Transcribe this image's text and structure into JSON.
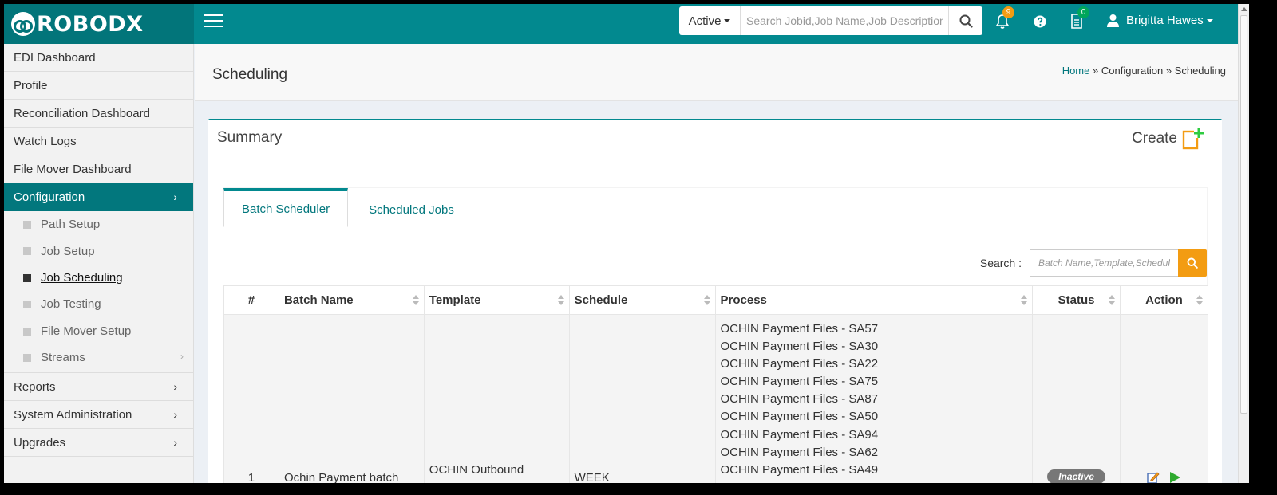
{
  "app": {
    "logo_text": "ROBODX"
  },
  "header": {
    "status_filter": "Active",
    "search_placeholder": "Search Jobid,Job Name,Job Description,Batch Name",
    "notifications_count": "9",
    "tasks_count": "0",
    "user_name": "Brigitta Hawes"
  },
  "sidebar": {
    "items": [
      {
        "label": "EDI Dashboard"
      },
      {
        "label": "Profile"
      },
      {
        "label": "Reconciliation Dashboard"
      },
      {
        "label": "Watch Logs"
      },
      {
        "label": "File Mover Dashboard"
      },
      {
        "label": "Configuration"
      },
      {
        "label": "Reports"
      },
      {
        "label": "System Administration"
      },
      {
        "label": "Upgrades"
      }
    ],
    "submenu": [
      {
        "label": "Path Setup"
      },
      {
        "label": "Job Setup"
      },
      {
        "label": "Job Scheduling"
      },
      {
        "label": "Job Testing"
      },
      {
        "label": "File Mover Setup"
      },
      {
        "label": "Streams"
      }
    ]
  },
  "page": {
    "title": "Scheduling",
    "breadcrumb": {
      "home": "Home",
      "sep": "»",
      "level1": "Configuration",
      "level2": "Scheduling"
    }
  },
  "summary": {
    "title": "Summary",
    "create_label": "Create",
    "tabs": [
      {
        "label": "Batch Scheduler"
      },
      {
        "label": "Scheduled Jobs"
      }
    ],
    "search_label": "Search :",
    "search_placeholder": "Batch Name,Template,Schedule",
    "columns": [
      "#",
      "Batch Name",
      "Template",
      "Schedule",
      "Process",
      "Status",
      "Action"
    ],
    "rows": [
      {
        "index": "1",
        "batch_name": "Ochin Payment batch",
        "template": "OCHIN Outbound",
        "schedule": "WEEK",
        "processes": [
          "OCHIN Payment Files - SA57",
          "OCHIN Payment Files - SA30",
          "OCHIN Payment Files - SA22",
          "OCHIN Payment Files - SA75",
          "OCHIN Payment Files - SA87",
          "OCHIN Payment Files - SA50",
          "OCHIN Payment Files - SA94",
          "OCHIN Payment Files - SA62",
          "OCHIN Payment Files - SA49"
        ],
        "status": "Inactive"
      }
    ]
  },
  "colors": {
    "teal": "#02898f",
    "teal_dark": "#02757a",
    "accent_orange": "#f39c12"
  }
}
